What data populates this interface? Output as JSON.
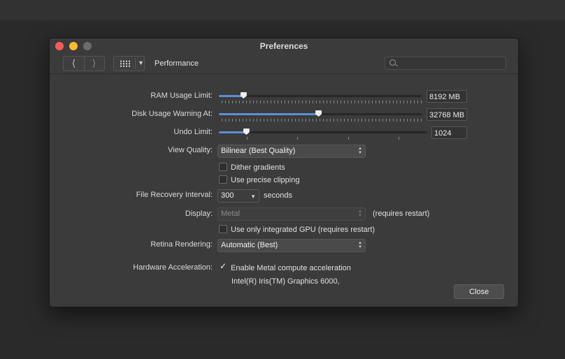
{
  "window": {
    "title": "Preferences"
  },
  "toolbar": {
    "back_icon": "chevron-left-icon",
    "forward_icon": "chevron-right-icon",
    "grid_icon": "grid-icon",
    "page_title": "Performance",
    "search_placeholder": ""
  },
  "settings": {
    "ram": {
      "label": "RAM Usage Limit:",
      "value": "8192 MB",
      "level": 0.12
    },
    "disk": {
      "label": "Disk Usage Warning At:",
      "value": "32768 MB",
      "level": 0.49
    },
    "undo": {
      "label": "Undo Limit:",
      "value": "1024",
      "level": 0.13
    },
    "view_quality": {
      "label": "View Quality:",
      "selected": "Bilinear (Best Quality)"
    },
    "dither": {
      "label": "Dither gradients",
      "checked": false
    },
    "precise_clipping": {
      "label": "Use precise clipping",
      "checked": false
    },
    "file_recovery": {
      "label": "File Recovery Interval:",
      "value": "300",
      "unit": "seconds"
    },
    "display": {
      "label": "Display:",
      "selected": "Metal",
      "note": "(requires restart)"
    },
    "integrated_gpu": {
      "label": "Use only integrated GPU (requires restart)",
      "checked": false
    },
    "retina": {
      "label": "Retina Rendering:",
      "selected": "Automatic (Best)"
    },
    "hw_accel": {
      "label": "Hardware Acceleration:",
      "checkbox_label": "Enable Metal compute acceleration",
      "checked": true,
      "gpu": "Intel(R) Iris(TM) Graphics 6000,"
    }
  },
  "buttons": {
    "close": "Close"
  },
  "colors": {
    "accent": "#5b8fd6",
    "close_light": "#fd5d56",
    "minimize_light": "#fdbc2d"
  }
}
